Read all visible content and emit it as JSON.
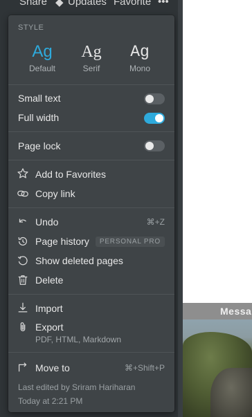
{
  "topbar": {
    "share": "Share",
    "updates": "Updates",
    "favorite": "Favorite",
    "more": "•••"
  },
  "macbar": {
    "app_name": "Messa"
  },
  "menu": {
    "style_label": "STYLE",
    "styles": [
      {
        "glyph": "Ag",
        "label": "Default",
        "selected": true
      },
      {
        "glyph": "Ag",
        "label": "Serif",
        "selected": false
      },
      {
        "glyph": "Ag",
        "label": "Mono",
        "selected": false
      }
    ],
    "small_text": {
      "label": "Small text",
      "on": false
    },
    "full_width": {
      "label": "Full width",
      "on": true
    },
    "page_lock": {
      "label": "Page lock",
      "on": false
    },
    "add_favorites": "Add to Favorites",
    "copy_link": "Copy link",
    "undo": {
      "label": "Undo",
      "shortcut": "⌘+Z"
    },
    "page_history": {
      "label": "Page history",
      "badge": "PERSONAL PRO"
    },
    "show_deleted": "Show deleted pages",
    "delete": "Delete",
    "import": "Import",
    "export": {
      "label": "Export",
      "sub": "PDF, HTML, Markdown"
    },
    "move_to": {
      "label": "Move to",
      "shortcut": "⌘+Shift+P"
    },
    "footer": {
      "last_edited": "Last edited by Sriram Hariharan",
      "time": "Today at 2:21 PM"
    }
  },
  "colors": {
    "accent": "#2eaadc",
    "menu_bg": "#3f4447",
    "app_bg": "#2f3437"
  }
}
